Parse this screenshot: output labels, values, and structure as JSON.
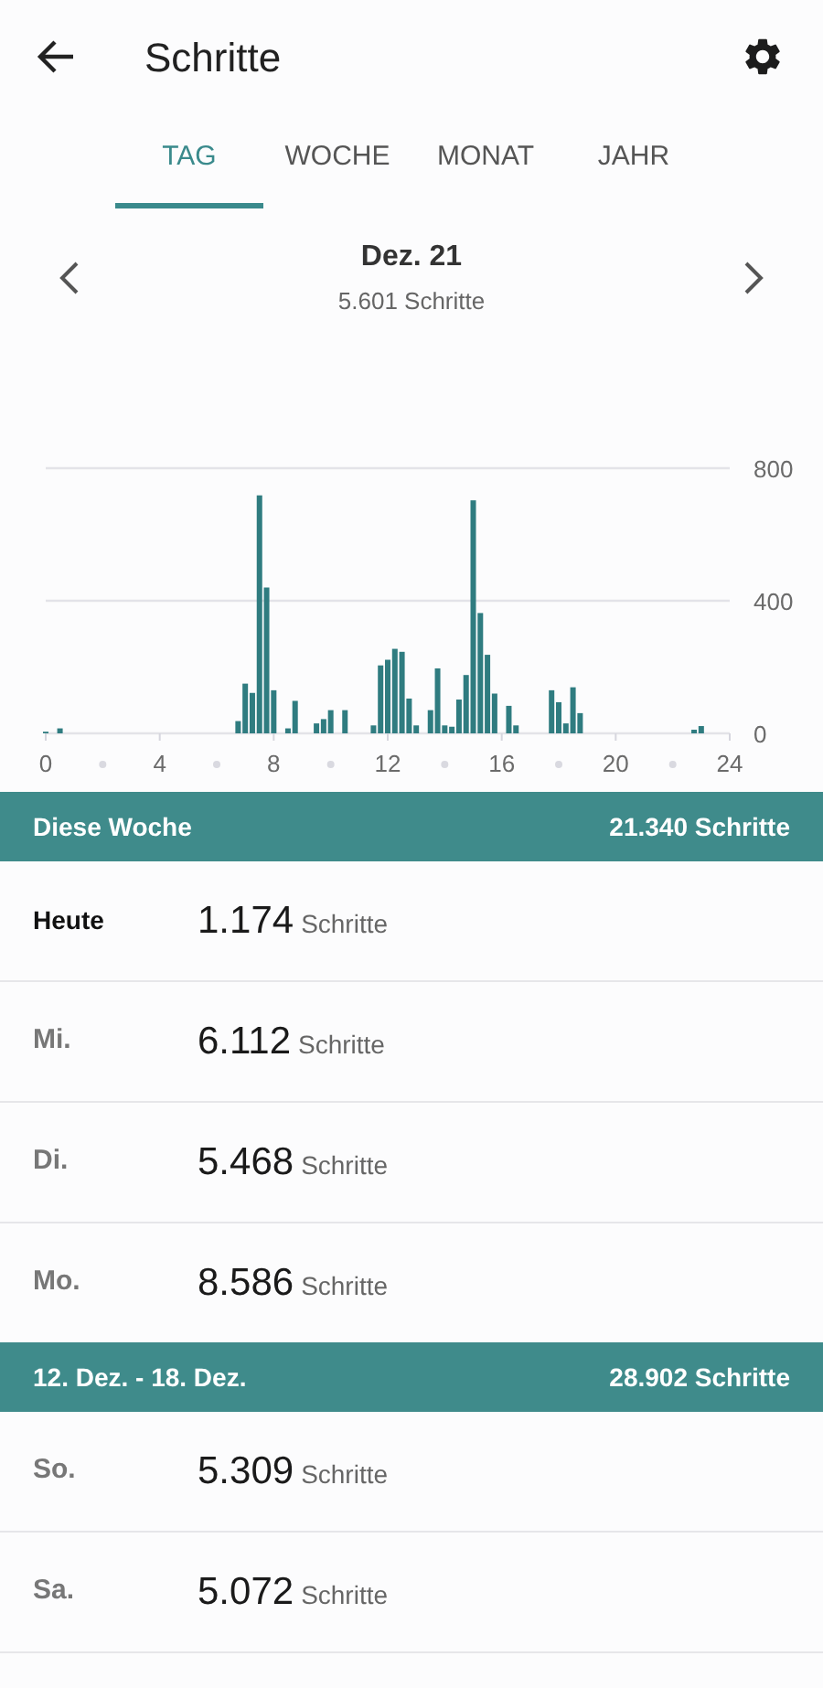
{
  "app_bar": {
    "title": "Schritte"
  },
  "tabs": [
    {
      "label": "TAG",
      "selected": true
    },
    {
      "label": "WOCHE",
      "selected": false
    },
    {
      "label": "MONAT",
      "selected": false
    },
    {
      "label": "JAHR",
      "selected": false
    }
  ],
  "period": {
    "title": "Dez. 21",
    "subtitle": "5.601 Schritte"
  },
  "chart_data": {
    "type": "bar",
    "xlim": [
      0,
      24
    ],
    "ylim": [
      0,
      800
    ],
    "xticks": [
      0,
      4,
      8,
      12,
      16,
      20,
      24
    ],
    "yticks": [
      0,
      400,
      800
    ],
    "x": [
      0,
      0.5,
      6.75,
      7,
      7.25,
      7.5,
      7.75,
      8,
      8.5,
      8.75,
      9.5,
      9.75,
      10,
      10.5,
      11.5,
      11.75,
      12,
      12.25,
      12.5,
      12.75,
      13,
      13.5,
      13.75,
      14,
      14.25,
      14.5,
      14.75,
      15,
      15.25,
      15.5,
      15.75,
      16.25,
      16.5,
      17.75,
      18,
      18.25,
      18.5,
      18.75,
      22.75,
      23
    ],
    "series": [
      {
        "color": "#2f7c80",
        "values": [
          5,
          15,
          37,
          150,
          122,
          718,
          440,
          130,
          15,
          98,
          30,
          43,
          70,
          70,
          24,
          205,
          222,
          255,
          246,
          105,
          24,
          70,
          196,
          24,
          20,
          102,
          176,
          703,
          363,
          237,
          120,
          83,
          24,
          130,
          94,
          30,
          139,
          61,
          11,
          22
        ]
      }
    ]
  },
  "sections": [
    {
      "title": "Diese Woche",
      "total": "21.340 Schritte",
      "days": [
        {
          "day": "Heute",
          "today": true,
          "count": "1.174",
          "unit": "Schritte"
        },
        {
          "day": "Mi.",
          "today": false,
          "count": "6.112",
          "unit": "Schritte"
        },
        {
          "day": "Di.",
          "today": false,
          "count": "5.468",
          "unit": "Schritte"
        },
        {
          "day": "Mo.",
          "today": false,
          "count": "8.586",
          "unit": "Schritte"
        }
      ]
    },
    {
      "title": "12. Dez. - 18. Dez.",
      "total": "28.902 Schritte",
      "days": [
        {
          "day": "So.",
          "today": false,
          "count": "5.309",
          "unit": "Schritte"
        },
        {
          "day": "Sa.",
          "today": false,
          "count": "5.072",
          "unit": "Schritte"
        }
      ]
    }
  ]
}
